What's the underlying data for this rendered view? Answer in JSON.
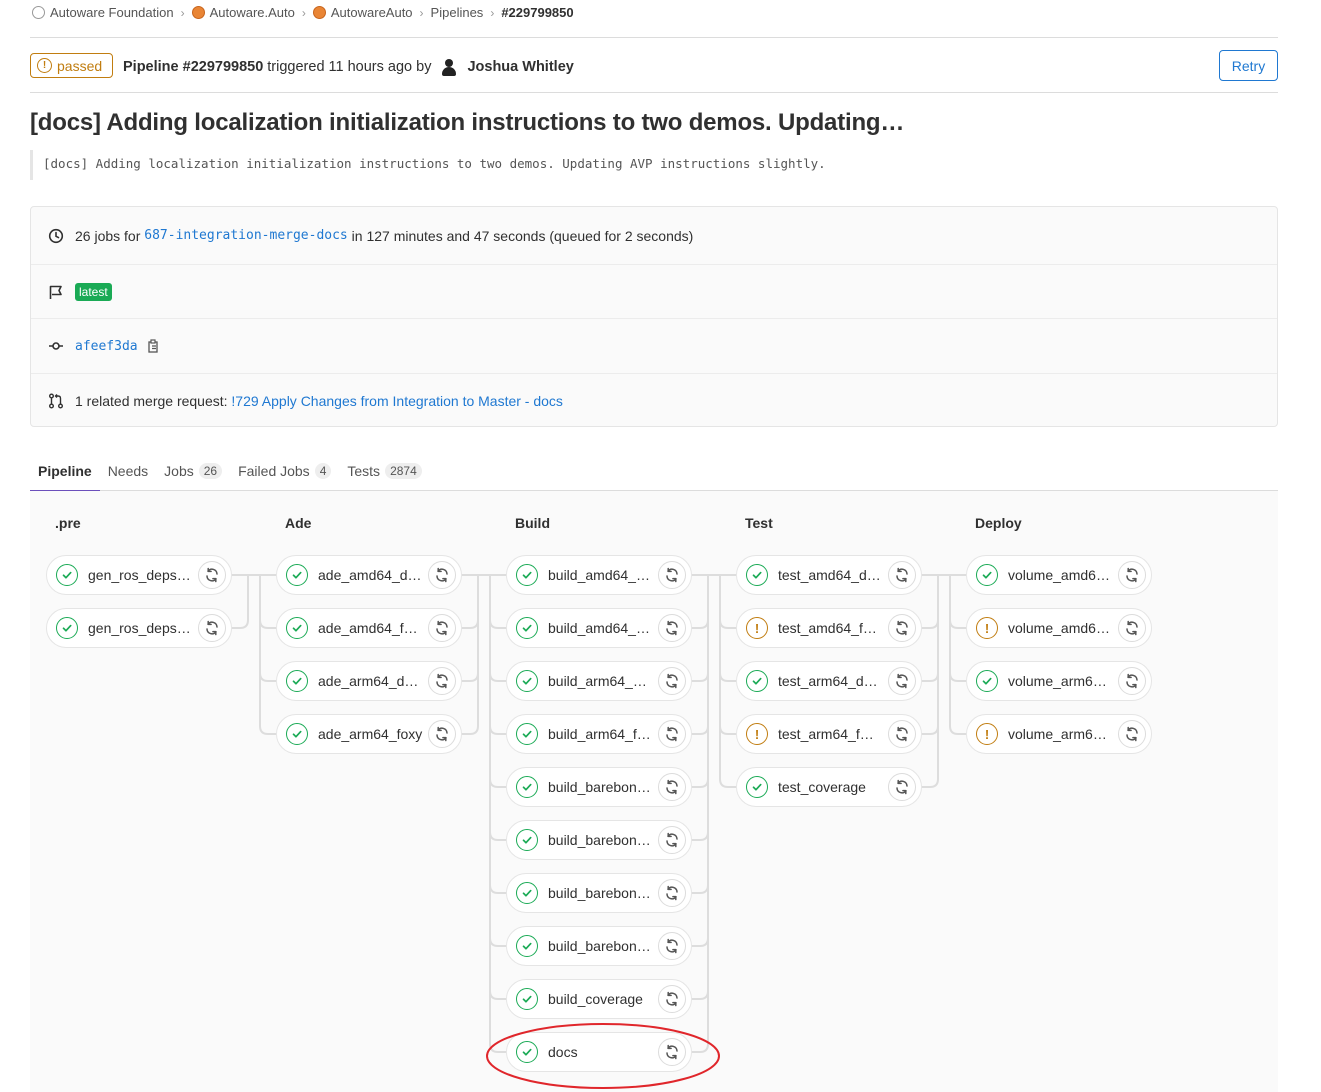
{
  "breadcrumb": [
    "Autoware Foundation",
    "Autoware.Auto",
    "AutowareAuto",
    "Pipelines",
    "#229799850"
  ],
  "header": {
    "status": "passed",
    "pipeline_label": "Pipeline #229799850",
    "triggered_text": "triggered 11 hours ago by",
    "user": "Joshua Whitley",
    "retry_label": "Retry"
  },
  "title": "[docs] Adding localization initialization instructions to two demos. Updating…",
  "commit_message": "[docs] Adding localization initialization instructions to two demos. Updating AVP instructions slightly.",
  "info": {
    "jobs_prefix": "26 jobs for",
    "branch": "687-integration-merge-docs",
    "jobs_suffix": "in 127 minutes and 47 seconds (queued for 2 seconds)",
    "tag": "latest",
    "commit_sha": "afeef3da",
    "mr_prefix": "1 related merge request:",
    "mr_link": "!729 Apply Changes from Integration to Master - docs"
  },
  "tabs": [
    {
      "label": "Pipeline",
      "count": ""
    },
    {
      "label": "Needs",
      "count": ""
    },
    {
      "label": "Jobs",
      "count": "26"
    },
    {
      "label": "Failed Jobs",
      "count": "4"
    },
    {
      "label": "Tests",
      "count": "2874"
    }
  ],
  "stages": [
    {
      "name": ".pre",
      "jobs": [
        {
          "name": "gen_ros_deps…",
          "status": "success"
        },
        {
          "name": "gen_ros_deps…",
          "status": "success"
        }
      ]
    },
    {
      "name": "Ade",
      "jobs": [
        {
          "name": "ade_amd64_d…",
          "status": "success"
        },
        {
          "name": "ade_amd64_f…",
          "status": "success"
        },
        {
          "name": "ade_arm64_d…",
          "status": "success"
        },
        {
          "name": "ade_arm64_foxy",
          "status": "success"
        }
      ]
    },
    {
      "name": "Build",
      "jobs": [
        {
          "name": "build_amd64_…",
          "status": "success"
        },
        {
          "name": "build_amd64_…",
          "status": "success"
        },
        {
          "name": "build_arm64_…",
          "status": "success"
        },
        {
          "name": "build_arm64_f…",
          "status": "success"
        },
        {
          "name": "build_barebon…",
          "status": "success"
        },
        {
          "name": "build_barebon…",
          "status": "success"
        },
        {
          "name": "build_barebon…",
          "status": "success"
        },
        {
          "name": "build_barebon…",
          "status": "success"
        },
        {
          "name": "build_coverage",
          "status": "success"
        },
        {
          "name": "docs",
          "status": "success"
        }
      ]
    },
    {
      "name": "Test",
      "jobs": [
        {
          "name": "test_amd64_d…",
          "status": "success"
        },
        {
          "name": "test_amd64_f…",
          "status": "warning"
        },
        {
          "name": "test_arm64_d…",
          "status": "success"
        },
        {
          "name": "test_arm64_f…",
          "status": "warning"
        },
        {
          "name": "test_coverage",
          "status": "success"
        }
      ]
    },
    {
      "name": "Deploy",
      "jobs": [
        {
          "name": "volume_amd6…",
          "status": "success"
        },
        {
          "name": "volume_amd6…",
          "status": "warning"
        },
        {
          "name": "volume_arm6…",
          "status": "success"
        },
        {
          "name": "volume_arm6…",
          "status": "warning"
        }
      ]
    }
  ],
  "colors": {
    "success": "#1aaa55",
    "warning": "#c17d10",
    "link": "#1f78d1",
    "annotation": "#e0262b"
  },
  "icons": {
    "status_success": "check-circle-icon",
    "status_warning": "exclamation-circle-icon",
    "job_action": "retry-icon"
  }
}
